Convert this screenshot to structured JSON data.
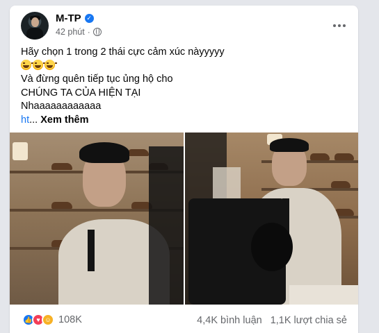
{
  "post": {
    "author": "M-TP",
    "verified": true,
    "time": "42 phút",
    "privacy_icon": "globe-icon",
    "more_icon": "more-options-icon",
    "lines": [
      "Hãy chọn 1 trong 2 thái cực cảm xúc nàyyyyy",
      "Và đừng quên tiếp tục ủng hộ cho",
      "CHÚNG TA CỦA HIỆN TẠI",
      "Nhaaaaaaaaaaaa"
    ],
    "emoji_count": 3,
    "link_fragment": "ht",
    "ellipsis": "...",
    "see_more": "Xem thêm"
  },
  "footer": {
    "reaction_icons": [
      "like-icon",
      "love-icon",
      "haha-icon"
    ],
    "reaction_count": "108K",
    "comments": "4,4K bình luận",
    "shares": "1,1K lượt chia sẻ"
  },
  "colors": {
    "accent": "#1877f2",
    "secondary_text": "#65676b",
    "love": "#f33e58",
    "haha": "#f7b125"
  }
}
